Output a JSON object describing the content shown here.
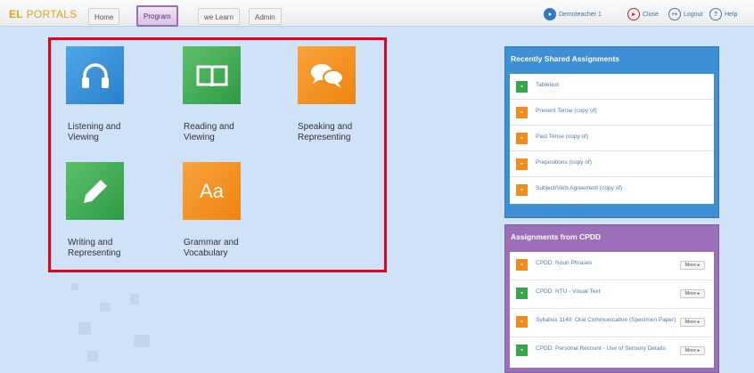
{
  "header": {
    "logo_primary": "EL",
    "logo_secondary": "PORTALS",
    "nav": [
      "Home",
      "Program",
      "we Learn",
      "Admin"
    ],
    "user": "Demoteacher 1",
    "actions": [
      "Close",
      "Logout",
      "Help"
    ]
  },
  "tiles": [
    {
      "label": "Listening and Viewing",
      "icon": "headphones-icon",
      "color": "#3a92db"
    },
    {
      "label": "Reading and Viewing",
      "icon": "book-icon",
      "color": "#43ad58"
    },
    {
      "label": "Speaking and Representing",
      "icon": "speech-bubbles-icon",
      "color": "#f39424"
    },
    {
      "label": "Writing and Representing",
      "icon": "pencil-icon",
      "color": "#43ad58"
    },
    {
      "label": "Grammar and Vocabulary",
      "icon": "aa-icon",
      "glyph": "Aa",
      "color": "#f39424"
    }
  ],
  "recently_shared": {
    "title": "Recently Shared Assignments",
    "items": [
      {
        "label": "Tabletext",
        "color": "green"
      },
      {
        "label": "Present Tense (copy of)",
        "color": "orange"
      },
      {
        "label": "Past Tense (copy of)",
        "color": "orange"
      },
      {
        "label": "Prepositions (copy of)",
        "color": "orange"
      },
      {
        "label": "Subject/Verb Agreement (copy of)",
        "color": "orange"
      }
    ]
  },
  "cpdd": {
    "title": "Assignments from CPDD",
    "more_label": "More ▸",
    "items": [
      {
        "label": "CPDD: Noun Phrases",
        "color": "orange"
      },
      {
        "label": "CPDD: NTU - Visual Text",
        "color": "green"
      },
      {
        "label": "Syllabus 1140: Oral Communication (Specimen Paper)",
        "color": "orange"
      },
      {
        "label": "CPDD: Personal Recount - Use of Sensory Details",
        "color": "green"
      }
    ]
  },
  "colors": {
    "highlight": "#e6001e",
    "panel_blue": "#3f8fd4",
    "panel_purple": "#9c70b8",
    "active_tab": "#9a6db5"
  }
}
